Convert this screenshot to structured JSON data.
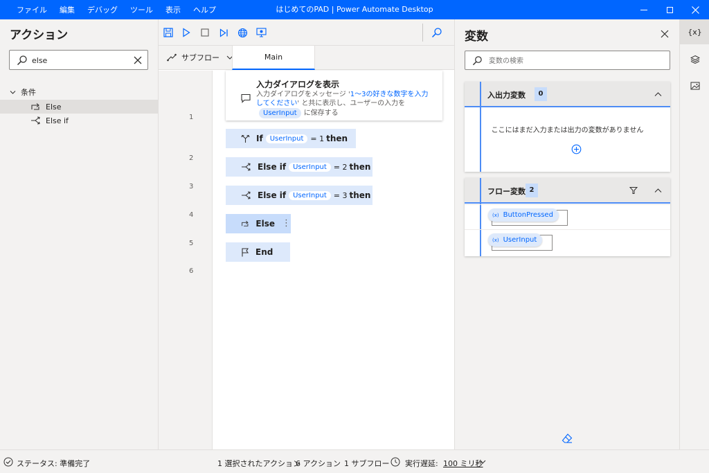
{
  "window": {
    "title": "はじめてのPAD | Power Automate Desktop",
    "menu": [
      "ファイル",
      "編集",
      "デバッグ",
      "ツール",
      "表示",
      "ヘルプ"
    ]
  },
  "actions_pane": {
    "title": "アクション",
    "search_value": "else",
    "category": "条件",
    "items": [
      {
        "label": "Else",
        "selected": true
      },
      {
        "label": "Else if",
        "selected": false
      }
    ]
  },
  "designer": {
    "subflow_label": "サブフロー",
    "tab_main": "Main",
    "steps": [
      {
        "line": "1",
        "title": "入力ダイアログを表示",
        "desc_pre": "入力ダイアログをメッセージ '",
        "desc_hl": "1～3の好きな数字を入力してください",
        "desc_mid": "' と共に表示し、ユーザーの入力を",
        "desc_var": "UserInput",
        "desc_post": "に保存する"
      },
      {
        "line": "2",
        "keyword": "If",
        "var": "UserInput",
        "op": "= 1",
        "then": "then"
      },
      {
        "line": "3",
        "keyword": "Else if",
        "var": "UserInput",
        "op": "= 2",
        "then": "then"
      },
      {
        "line": "4",
        "keyword": "Else if",
        "var": "UserInput",
        "op": "= 3",
        "then": "then"
      },
      {
        "line": "5",
        "keyword": "Else"
      },
      {
        "line": "6",
        "keyword": "End"
      }
    ]
  },
  "variables_pane": {
    "title": "変数",
    "search_placeholder": "変数の検索",
    "io_section": {
      "title": "入出力変数",
      "count": "0",
      "empty_message": "ここにはまだ入力または出力の変数がありません"
    },
    "flow_section": {
      "title": "フロー変数",
      "count": "2",
      "vars": [
        "ButtonPressed",
        "UserInput"
      ]
    }
  },
  "rail": {
    "vars_label": "{x}"
  },
  "status": {
    "state": "ステータス: 準備完了",
    "selected": "1 選択されたアクション",
    "actions": "6 アクション",
    "subflows": "1 サブフロー",
    "delay_label": "実行遅延:",
    "delay_value": "100 ミリ秒"
  },
  "colors": {
    "accent": "#0066ff",
    "step_bg": "#dde9fb",
    "chip_bg": "#c7dcfb"
  }
}
